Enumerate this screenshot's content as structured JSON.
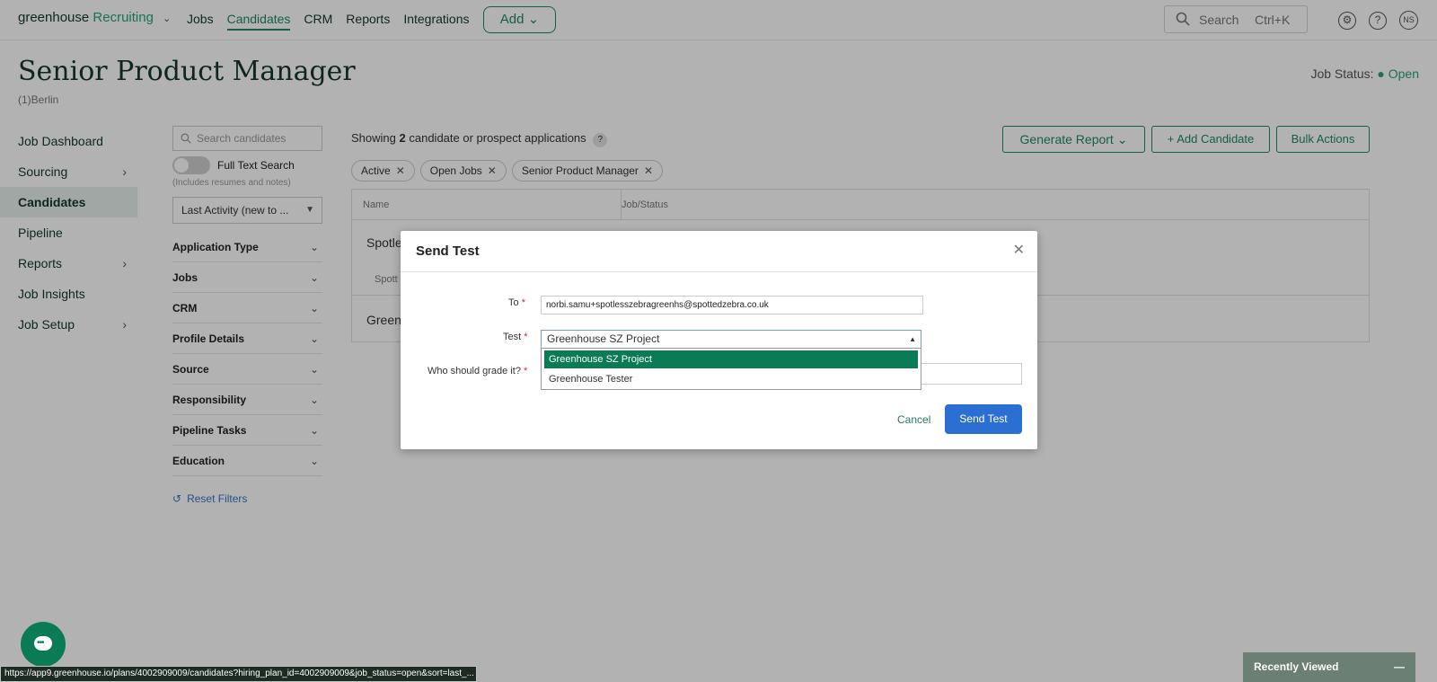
{
  "topnav": {
    "logo_main": "greenhouse",
    "logo_sub": "Recruiting",
    "links": [
      "Jobs",
      "Candidates",
      "CRM",
      "Reports",
      "Integrations"
    ],
    "active_link": "Candidates",
    "add_label": "Add",
    "search_label": "Search",
    "search_shortcut": "Ctrl+K",
    "avatar_initials": "NS"
  },
  "header": {
    "title": "Senior Product Manager",
    "location": "(1)Berlin",
    "job_status_label": "Job Status:",
    "job_status_value": "Open"
  },
  "leftnav": {
    "items": [
      {
        "label": "Job Dashboard",
        "chevron": false,
        "selected": false
      },
      {
        "label": "Sourcing",
        "chevron": true,
        "selected": false
      },
      {
        "label": "Candidates",
        "chevron": false,
        "selected": true
      },
      {
        "label": "Pipeline",
        "chevron": false,
        "selected": false
      },
      {
        "label": "Reports",
        "chevron": true,
        "selected": false
      },
      {
        "label": "Job Insights",
        "chevron": false,
        "selected": false
      },
      {
        "label": "Job Setup",
        "chevron": true,
        "selected": false
      }
    ]
  },
  "filters": {
    "search_placeholder": "Search candidates",
    "full_text_label": "Full Text Search",
    "full_text_hint": "(Includes resumes and notes)",
    "sort_value": "Last Activity (new to ...",
    "facets": [
      "Application Type",
      "Jobs",
      "CRM",
      "Profile Details",
      "Source",
      "Responsibility",
      "Pipeline Tasks",
      "Education"
    ],
    "reset_label": "Reset Filters"
  },
  "main": {
    "showing_pre": "Showing",
    "showing_count": "2",
    "showing_post": "candidate or prospect applications",
    "chips": [
      "Active",
      "Open Jobs",
      "Senior Product Manager"
    ],
    "generate_report_label": "Generate Report",
    "add_candidate_label": "+ Add Candidate",
    "bulk_actions_label": "Bulk Actions",
    "col_name": "Name",
    "col_job_status": "Job/Status",
    "row1_name": "Spotle",
    "row1_sub": "Spott",
    "row2_name": "Green"
  },
  "modal": {
    "title": "Send Test",
    "to_label": "To",
    "to_value": "norbi.samu+spotlesszebragreenhs@spottedzebra.co.uk",
    "test_label": "Test",
    "test_value": "Greenhouse SZ Project",
    "test_options": [
      "Greenhouse SZ Project",
      "Greenhouse Tester"
    ],
    "grader_label": "Who should grade it?",
    "cancel_label": "Cancel",
    "send_label": "Send Test"
  },
  "statusbar": {
    "url": "https://app9.greenhouse.io/plans/4002909009/candidates?hiring_plan_id=4002909009&job_status=open&sort=last_..."
  },
  "recently_viewed": {
    "label": "Recently Viewed"
  },
  "colors": {
    "brand_green": "#24a47f",
    "selected_option": "#0b7b56",
    "primary_button": "#2c6fd2"
  }
}
